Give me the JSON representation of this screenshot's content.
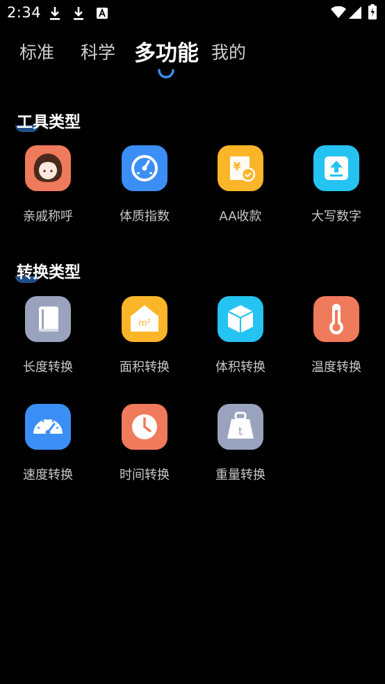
{
  "status_bar": {
    "time": "2:34",
    "icons": [
      "download-icon",
      "download-icon",
      "accessibility-icon",
      "wifi-icon",
      "signal-icon",
      "battery-icon"
    ]
  },
  "tabs": [
    {
      "label": "标准",
      "active": false
    },
    {
      "label": "科学",
      "active": false
    },
    {
      "label": "多功能",
      "active": true
    },
    {
      "label": "我的",
      "active": false
    }
  ],
  "sections": {
    "tools": {
      "title": "工具类型",
      "items": [
        {
          "label": "亲戚称呼",
          "icon": "relative-face-icon",
          "color": "#f07a5c"
        },
        {
          "label": "体质指数",
          "icon": "gauge-icon",
          "color": "#3b8ef5"
        },
        {
          "label": "AA收款",
          "icon": "yuan-payment-icon",
          "color": "#fbb528"
        },
        {
          "label": "大写数字",
          "icon": "upload-arrow-icon",
          "color": "#25c3f2"
        }
      ]
    },
    "conversion": {
      "title": "转换类型",
      "items": [
        {
          "label": "长度转换",
          "icon": "book-icon",
          "color": "#9aa3bd"
        },
        {
          "label": "面积转换",
          "icon": "house-m2-icon",
          "color": "#fbb528"
        },
        {
          "label": "体积转换",
          "icon": "cube-icon",
          "color": "#25c3f2"
        },
        {
          "label": "温度转换",
          "icon": "thermometer-icon",
          "color": "#f07a5c"
        },
        {
          "label": "速度转换",
          "icon": "speedometer-icon",
          "color": "#3b8ef5"
        },
        {
          "label": "时间转换",
          "icon": "clock-icon",
          "color": "#f07a5c"
        },
        {
          "label": "重量转换",
          "icon": "weight-icon",
          "color": "#9aa3bd"
        }
      ]
    }
  }
}
